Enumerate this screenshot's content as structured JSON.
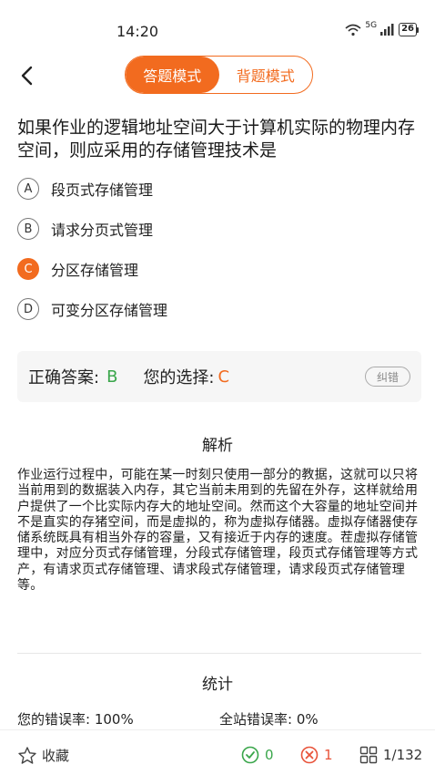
{
  "status_bar": {
    "time": "14:20",
    "network": "5G",
    "battery": "26"
  },
  "header": {
    "modes": [
      {
        "label": "答题模式",
        "active": true
      },
      {
        "label": "背题模式",
        "active": false
      }
    ]
  },
  "question": {
    "text": "如果作业的逻辑地址空间大于计算机实际的物理内存空间，则应采用的存储管理技术是",
    "options": [
      {
        "key": "A",
        "text": "段页式存储管理",
        "selected": false
      },
      {
        "key": "B",
        "text": "请求分页式管理",
        "selected": false
      },
      {
        "key": "C",
        "text": "分区存储管理",
        "selected": true
      },
      {
        "key": "D",
        "text": "可变分区存储管理",
        "selected": false
      }
    ]
  },
  "answer": {
    "correct_label": "正确答案:",
    "correct_value": "B",
    "choice_label": "您的选择:",
    "choice_value": "C",
    "report_label": "纠错"
  },
  "analysis": {
    "title": "解析",
    "text": "作业运行过程中，可能在某一时刻只使用一部分的教据，这就可以只将当前用到的数据装入内存，其它当前未用到的先留在外存，这样就给用户提供了一个比实际内存大的地址空间。然而这个大容量的地址空间并不是直实的存猪空间，而是虚拟的，称为虚拟存储器。虚拟存储器使存储系统既具有相当外存的容量，又有接近于内存的速度。茬虚拟存储管理中，对应分页式存储管理，分段式存储管理，段页式存储管理等方式产，有请求页式存储管理、请求段式存储管理，请求段页式存储管理等。"
  },
  "statistics": {
    "title": "统计",
    "my_error_rate": "您的错误率: 100%",
    "site_error_rate": "全站错误率: 0%"
  },
  "bottom_bar": {
    "favorite_label": "收藏",
    "correct_count": "0",
    "wrong_count": "1",
    "progress": "1/132"
  },
  "colors": {
    "accent": "#f26b1f",
    "correct": "#3aa64b",
    "wrong": "#e8533a"
  }
}
